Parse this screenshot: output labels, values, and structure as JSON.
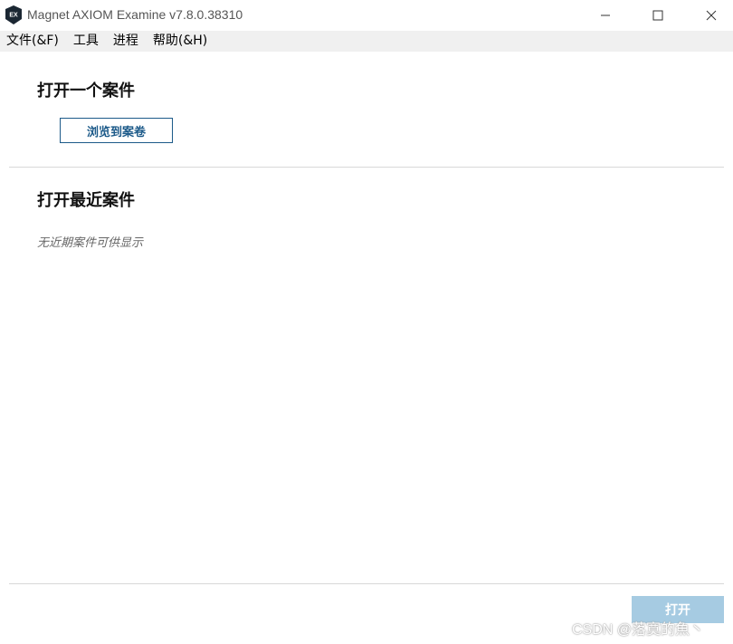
{
  "window": {
    "title": "Magnet AXIOM Examine v7.8.0.38310",
    "app_icon_label": "EX",
    "controls": [
      "minimize-icon",
      "maximize-icon",
      "close-icon"
    ]
  },
  "menu": {
    "items": [
      {
        "label": "文件(&F)"
      },
      {
        "label": "工具"
      },
      {
        "label": "进程"
      },
      {
        "label": "帮助(&H)"
      }
    ]
  },
  "open_case": {
    "title": "打开一个案件",
    "browse_label": "浏览到案卷"
  },
  "recent_cases": {
    "title": "打开最近案件",
    "empty_text": "无近期案件可供显示"
  },
  "footer": {
    "open_label": "打开"
  },
  "watermark": "CSDN @落寞的魚丶",
  "colors": {
    "accent": "#1c5a89",
    "disabled_button": "#a6cbe2",
    "menubar_bg": "#f0f0f0"
  }
}
